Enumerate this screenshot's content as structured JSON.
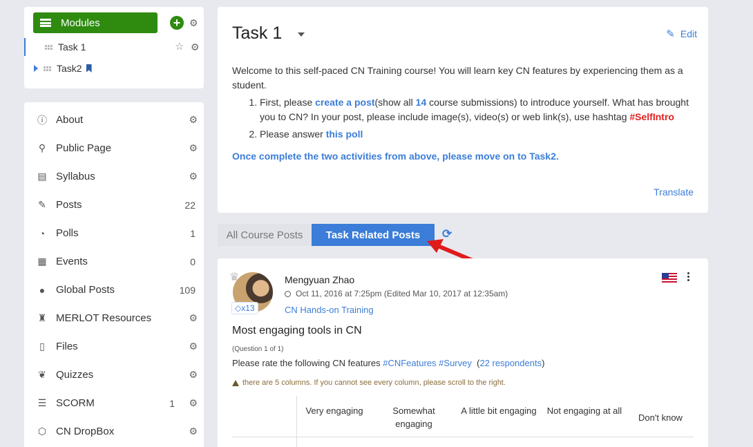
{
  "modules": {
    "button_label": "Modules",
    "items": [
      {
        "label": "Task 1",
        "active": true
      },
      {
        "label": "Task2",
        "active": false
      }
    ]
  },
  "nav": [
    {
      "label": "About",
      "icon": "info-icon",
      "count": "",
      "gear": true
    },
    {
      "label": "Public Page",
      "icon": "thumbtack-icon",
      "count": "",
      "gear": true
    },
    {
      "label": "Syllabus",
      "icon": "document-icon",
      "count": "",
      "gear": true
    },
    {
      "label": "Posts",
      "icon": "edit-icon",
      "count": "22",
      "gear": false
    },
    {
      "label": "Polls",
      "icon": "pie-icon",
      "count": "1",
      "gear": false
    },
    {
      "label": "Events",
      "icon": "calendar-icon",
      "count": "0",
      "gear": false
    },
    {
      "label": "Global Posts",
      "icon": "globe-icon",
      "count": "109",
      "gear": false
    },
    {
      "label": "MERLOT Resources",
      "icon": "merlot-icon",
      "count": "",
      "gear": true
    },
    {
      "label": "Files",
      "icon": "file-icon",
      "count": "",
      "gear": true
    },
    {
      "label": "Quizzes",
      "icon": "brain-icon",
      "count": "",
      "gear": true
    },
    {
      "label": "SCORM",
      "icon": "scorm-icon",
      "count": "1",
      "gear": true
    },
    {
      "label": "CN DropBox",
      "icon": "box-icon",
      "count": "",
      "gear": true
    }
  ],
  "task": {
    "title": "Task 1",
    "edit_label": "Edit",
    "intro": "Welcome to this self-paced CN Training course! You will learn key CN features by experiencing them as a student.",
    "step1_a": "First, please ",
    "step1_link": "create a post",
    "step1_b": "(show all ",
    "step1_count": "14",
    "step1_c": " course submissions) to introduce yourself. What has brought you to CN? In your post, please include image(s), video(s) or web link(s), use hashtag ",
    "step1_hashtag": "#SelfIntro",
    "step2_a": "Please answer ",
    "step2_link": "this poll",
    "once": "Once complete the two activities from above, please move on to Task2.",
    "translate": "Translate"
  },
  "tabs": {
    "all": "All Course Posts",
    "task": "Task Related Posts"
  },
  "post": {
    "author": "Mengyuan Zhao",
    "badge": "x13",
    "meta": "Oct 11, 2016 at 7:25pm (Edited Mar 10, 2017 at 12:35am)",
    "course": "CN Hands-on Training",
    "title": "Most engaging tools in CN",
    "question_of": "(Question 1 of 1)",
    "rate_text": "Please rate the following CN features ",
    "tag1": "#CNFeatures",
    "tag2": "#Survey",
    "respondents": "22 respondents",
    "warning": "there are 5 columns. If you cannot see every column, please scroll to the right.",
    "columns": [
      "Very engaging",
      "Somewhat engaging",
      "A little bit engaging",
      "Not engaging at all",
      "Don't know"
    ]
  }
}
